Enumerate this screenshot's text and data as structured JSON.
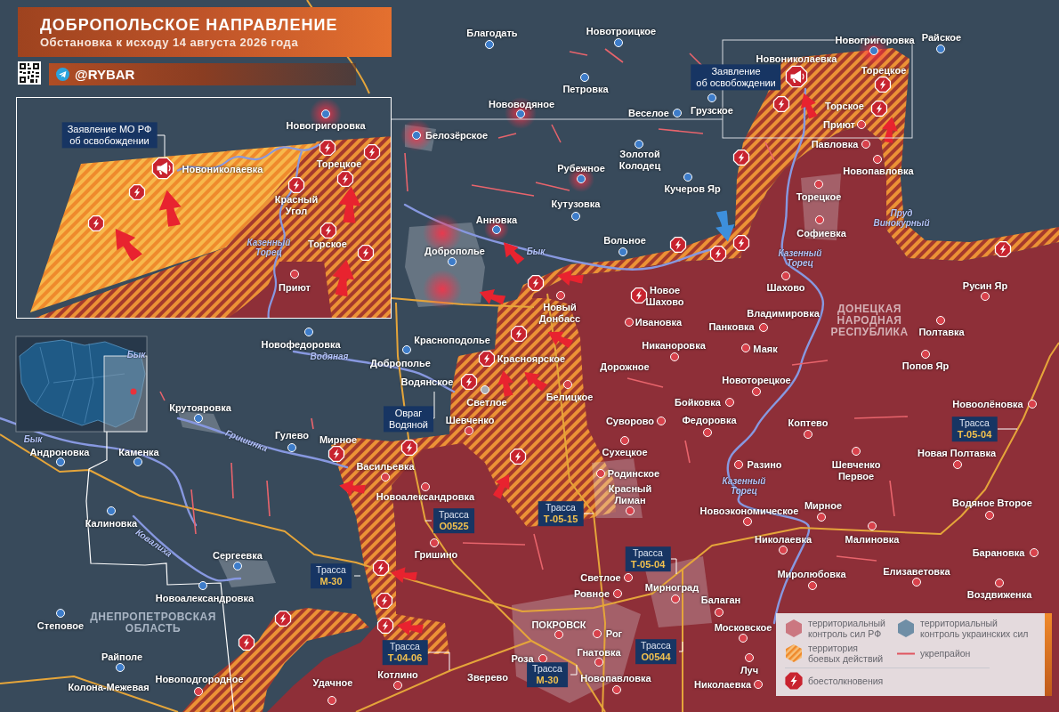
{
  "header": {
    "title": "ДОБРОПОЛЬСКОЕ НАПРАВЛЕНИЕ",
    "subtitle": "Обстановка к исходу 14 августа 2026 года",
    "channel": "@RYBAR"
  },
  "inset": {
    "callout": {
      "lines": [
        "Заявление МО РФ",
        "об освобождении"
      ]
    },
    "places": [
      {
        "name": "Новогригоровка",
        "color": "#3d7cc9"
      },
      {
        "name": "Новониколаевка"
      },
      {
        "name": "Торецкое"
      },
      {
        "name": "Красный Угол"
      },
      {
        "name": "Торское"
      },
      {
        "name": "Приют",
        "color": "#d8414b"
      }
    ],
    "rivers": [
      {
        "name": "Казенный Торец"
      }
    ]
  },
  "map": {
    "places": [
      {
        "name": "Благодать",
        "color": "#3d7cc9"
      },
      {
        "name": "Новотроицкое",
        "color": "#3d7cc9"
      },
      {
        "name": "Новогригоровка",
        "color": "#3d7cc9"
      },
      {
        "name": "Райское",
        "color": "#3d7cc9"
      },
      {
        "name": "Новониколаевка"
      },
      {
        "name": "Торецкое"
      },
      {
        "name": "Петровка",
        "color": "#3d7cc9"
      },
      {
        "name": "Нововодяное",
        "color": "#3d7cc9"
      },
      {
        "name": "Веселое",
        "color": "#3d7cc9"
      },
      {
        "name": "Грузское",
        "color": "#3d7cc9"
      },
      {
        "name": "Торское"
      },
      {
        "name": "Приют",
        "color": "#d8414b"
      },
      {
        "name": "Белозёрское",
        "color": "#3d7cc9"
      },
      {
        "name": "Павловка",
        "color": "#d8414b"
      },
      {
        "name": "Рубежное",
        "color": "#3d7cc9"
      },
      {
        "name": "Золотой Колодец",
        "color": "#3d7cc9"
      },
      {
        "name": "Новопавловка",
        "color": "#d8414b"
      },
      {
        "name": "Кучеров Яр",
        "color": "#3d7cc9"
      },
      {
        "name": "Торецкое",
        "color": "#d8414b"
      },
      {
        "name": "Кутузовка",
        "color": "#3d7cc9"
      },
      {
        "name": "Анновка",
        "color": "#3d7cc9"
      },
      {
        "name": "Вольное",
        "color": "#3d7cc9"
      },
      {
        "name": "Софиевка",
        "color": "#d8414b"
      },
      {
        "name": "Доброполье",
        "color": "#3d7cc9"
      },
      {
        "name": "Новое Шахово"
      },
      {
        "name": "Шахово",
        "color": "#d8414b"
      },
      {
        "name": "Русин Яр",
        "color": "#d8414b"
      },
      {
        "name": "Новый Донбасс",
        "color": "#d8414b"
      },
      {
        "name": "Ивановка",
        "color": "#d8414b"
      },
      {
        "name": "Владимировка"
      },
      {
        "name": "Панковка",
        "color": "#d8414b"
      },
      {
        "name": "Полтавка",
        "color": "#d8414b"
      },
      {
        "name": "Новофедоровка",
        "color": "#3d7cc9"
      },
      {
        "name": "Красноподолье",
        "color": "#3d7cc9"
      },
      {
        "name": "Никаноровка",
        "color": "#d8414b"
      },
      {
        "name": "Маяк",
        "color": "#d8414b"
      },
      {
        "name": "Доброполье"
      },
      {
        "name": "Красноярское"
      },
      {
        "name": "Дорожное"
      },
      {
        "name": "Попов Яр",
        "color": "#d8414b"
      },
      {
        "name": "Водянское"
      },
      {
        "name": "Новоторецкое",
        "color": "#d8414b"
      },
      {
        "name": "Крутояровка",
        "color": "#3d7cc9"
      },
      {
        "name": "Светлое",
        "color": "#a8adb5"
      },
      {
        "name": "Белицкое",
        "color": "#d8414b"
      },
      {
        "name": "Бойковка",
        "color": "#d8414b"
      },
      {
        "name": "Новоолёновка",
        "color": "#d8414b"
      },
      {
        "name": "Шевченко",
        "color": "#d8414b"
      },
      {
        "name": "Суворово",
        "color": "#d8414b"
      },
      {
        "name": "Федоровка",
        "color": "#d8414b"
      },
      {
        "name": "Коптево",
        "color": "#d8414b"
      },
      {
        "name": "Гулево",
        "color": "#3d7cc9"
      },
      {
        "name": "Мирное"
      },
      {
        "name": "Андроновка",
        "color": "#3d7cc9"
      },
      {
        "name": "Каменка",
        "color": "#3d7cc9"
      },
      {
        "name": "Сухецкое",
        "color": "#d8414b"
      },
      {
        "name": "Новая Полтавка",
        "color": "#d8414b"
      },
      {
        "name": "Васильевка",
        "color": "#d8414b"
      },
      {
        "name": "Родинское",
        "color": "#d8414b"
      },
      {
        "name": "Разино",
        "color": "#d8414b"
      },
      {
        "name": "Шевченко Первое",
        "color": "#d8414b"
      },
      {
        "name": "Новоалександровка",
        "color": "#d8414b"
      },
      {
        "name": "Красный Лиман",
        "color": "#d8414b"
      },
      {
        "name": "Новоэкономическое",
        "color": "#d8414b"
      },
      {
        "name": "Мирное",
        "color": "#d8414b"
      },
      {
        "name": "Водяное Второе",
        "color": "#d8414b"
      },
      {
        "name": "Калиновка",
        "color": "#3d7cc9"
      },
      {
        "name": "Николаевка",
        "color": "#d8414b"
      },
      {
        "name": "Малиновка",
        "color": "#d8414b"
      },
      {
        "name": "Сергеевка",
        "color": "#3d7cc9"
      },
      {
        "name": "Гришино",
        "color": "#d8414b"
      },
      {
        "name": "Барановка",
        "color": "#d8414b"
      },
      {
        "name": "Светлое",
        "color": "#d8414b"
      },
      {
        "name": "Миролюбовка",
        "color": "#d8414b"
      },
      {
        "name": "Елизаветовка",
        "color": "#d8414b"
      },
      {
        "name": "Новоалександровка",
        "color": "#3d7cc9"
      },
      {
        "name": "Ровное",
        "color": "#d8414b"
      },
      {
        "name": "Мирноград",
        "color": "#d8414b"
      },
      {
        "name": "Балаган",
        "color": "#d8414b"
      },
      {
        "name": "Воздвиженка",
        "color": "#d8414b"
      },
      {
        "name": "Степовое",
        "color": "#3d7cc9"
      },
      {
        "name": "ПОКРОВСК",
        "color": "#d8414b"
      },
      {
        "name": "Рог",
        "color": "#d8414b"
      },
      {
        "name": "Московское",
        "color": "#d8414b"
      },
      {
        "name": "Райполе",
        "color": "#3d7cc9"
      },
      {
        "name": "Роза",
        "color": "#d8414b"
      },
      {
        "name": "Гнатовка",
        "color": "#d8414b"
      },
      {
        "name": "Колона-Межевая"
      },
      {
        "name": "Новоподгородное",
        "color": "#d8414b"
      },
      {
        "name": "Удачное",
        "color": "#d8414b"
      },
      {
        "name": "Котлино",
        "color": "#d8414b"
      },
      {
        "name": "Зверево"
      },
      {
        "name": "Новопавловка",
        "color": "#d8414b"
      },
      {
        "name": "Николаевка",
        "color": "#d8414b"
      },
      {
        "name": "Луч",
        "color": "#d8414b"
      }
    ],
    "rivers": [
      {
        "name": "Пруд Винокурный"
      },
      {
        "name": "Бык"
      },
      {
        "name": "Казенный Торец"
      },
      {
        "name": "Бык"
      },
      {
        "name": "Водяная"
      },
      {
        "name": "Бык"
      },
      {
        "name": "Гришинка"
      },
      {
        "name": "Казенный Торец"
      },
      {
        "name": "Ковалиха"
      }
    ],
    "regions": [
      {
        "name": "ДОНЕЦКАЯ НАРОДНАЯ РЕСПУБЛИКА"
      },
      {
        "name": "ДНЕПРОПЕТРОВСКАЯ ОБЛАСТЬ"
      }
    ],
    "callouts": [
      {
        "lines": [
          "Заявление",
          "об освобождении"
        ]
      },
      {
        "lines": [
          "Овраг",
          "Водяной"
        ]
      }
    ],
    "roads": [
      {
        "label": "Трасса",
        "code": "Т-05-04"
      },
      {
        "label": "Трасса",
        "code": "О0525"
      },
      {
        "label": "Трасса",
        "code": "Т-05-15"
      },
      {
        "label": "Трасса",
        "code": "М-30"
      },
      {
        "label": "Трасса",
        "code": "Т-05-04"
      },
      {
        "label": "Трасса",
        "code": "Т-04-06"
      },
      {
        "label": "Трасса",
        "code": "О0544"
      },
      {
        "label": "Трасса",
        "code": "М-30"
      }
    ]
  },
  "legend": {
    "items": [
      {
        "kind": "rf",
        "lines": [
          "территориальный",
          "контроль сил РФ"
        ]
      },
      {
        "kind": "ua",
        "lines": [
          "территориальный",
          "контроль украинских сил"
        ]
      },
      {
        "kind": "combat",
        "lines": [
          "территория",
          "боевых действий"
        ]
      },
      {
        "kind": "fortification",
        "lines": [
          "укрепрайон"
        ]
      },
      {
        "kind": "clash",
        "lines": [
          "боестолкновения"
        ]
      }
    ]
  }
}
